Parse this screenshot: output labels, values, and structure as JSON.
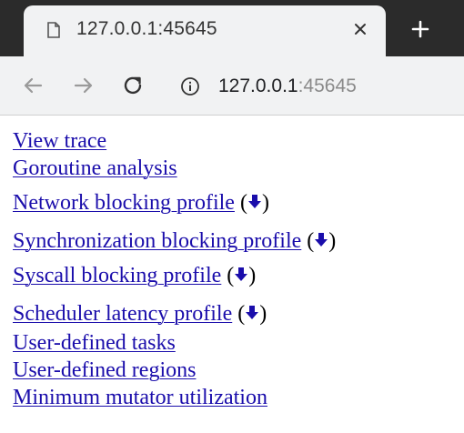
{
  "browser": {
    "tab": {
      "title": "127.0.0.1:45645",
      "icon": "document-icon",
      "close_icon": "close-icon"
    },
    "new_tab_icon": "plus-icon",
    "toolbar": {
      "back_icon": "arrow-left-icon",
      "forward_icon": "arrow-right-icon",
      "reload_icon": "reload-icon",
      "site_info_icon": "info-icon",
      "url_host": "127.0.0.1",
      "url_port": ":45645"
    }
  },
  "page": {
    "links": [
      {
        "label": "View trace",
        "download": false
      },
      {
        "label": "Goroutine analysis",
        "download": false
      },
      {
        "label": "Network blocking profile",
        "download": true
      },
      {
        "label": "Synchronization blocking profile",
        "download": true
      },
      {
        "label": "Syscall blocking profile",
        "download": true
      },
      {
        "label": "Scheduler latency profile",
        "download": true
      },
      {
        "label": "User-defined tasks",
        "download": false
      },
      {
        "label": "User-defined regions",
        "download": false
      },
      {
        "label": "Minimum mutator utilization",
        "download": false
      }
    ],
    "download_icon": "download-arrow-icon",
    "paren_open": "(",
    "paren_close": ")"
  },
  "colors": {
    "link": "#1a0dab",
    "tabstrip": "#2b2b2b",
    "toolbar": "#f1f2f3"
  }
}
